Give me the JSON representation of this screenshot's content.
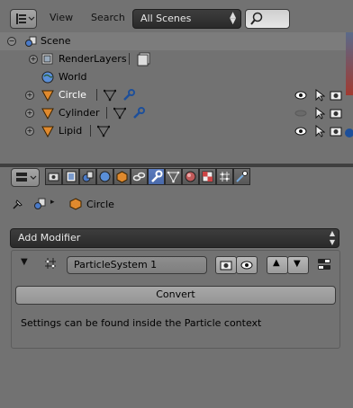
{
  "outliner": {
    "menus": [
      "View",
      "Search"
    ],
    "scene_dropdown": "All Scenes",
    "tree": [
      {
        "label": "Scene",
        "type": "scene"
      },
      {
        "label": "RenderLayers",
        "type": "renderlayers"
      },
      {
        "label": "World",
        "type": "world"
      },
      {
        "label": "Circle",
        "type": "object"
      },
      {
        "label": "Cylinder",
        "type": "object"
      },
      {
        "label": "Lipid",
        "type": "object"
      }
    ]
  },
  "properties": {
    "breadcrumb_object": "Circle",
    "add_modifier": "Add Modifier",
    "modifier_name": "ParticleSystem 1",
    "convert_label": "Convert",
    "info_text": "Settings can be found inside the Particle context",
    "tab_icons": [
      "render-icon",
      "render-layers-icon",
      "scene-icon",
      "world-icon",
      "object-icon",
      "constraints-icon",
      "modifiers-icon",
      "data-icon",
      "material-icon",
      "texture-icon",
      "particles-icon",
      "physics-icon"
    ],
    "active_tab": "modifiers-icon"
  },
  "colors": {
    "accent": "#5b7bbd",
    "panel_bg": "#727272",
    "header_dark": "#2a2a2a",
    "object_orange": "#e08a2e"
  }
}
